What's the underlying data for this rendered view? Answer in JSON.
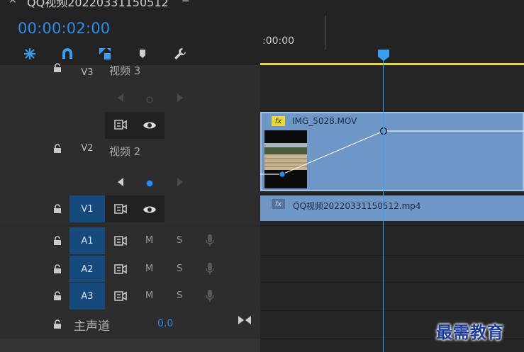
{
  "sequence": {
    "tab_close": "×",
    "tab_name": "QQ视频20220331150512",
    "tab_menu": "≡",
    "timecode": "00:00:02:00"
  },
  "toolbar": {
    "icons": [
      "snap-icon",
      "linked-selection-icon",
      "add-marker-icon",
      "marker-icon",
      "wrench-icon"
    ]
  },
  "ruler": {
    "label": ":00:00"
  },
  "tracks": {
    "v3": {
      "label": "V3",
      "name": "视频 3"
    },
    "v2": {
      "label": "V2",
      "name": "视频 2"
    },
    "v1": {
      "label": "V1"
    },
    "a1": {
      "label": "A1",
      "m": "M",
      "s": "S"
    },
    "a2": {
      "label": "A2",
      "m": "M",
      "s": "S"
    },
    "a3": {
      "label": "A3",
      "m": "M",
      "s": "S"
    },
    "master": {
      "name": "主声道",
      "value": "0.0"
    }
  },
  "clips": {
    "v2": {
      "fx": "fx",
      "name": "IMG_5028.MOV"
    },
    "v1": {
      "fx": "fx",
      "name": "QQ视频20220331150512.mp4"
    }
  },
  "watermark": "最需教育",
  "colors": {
    "accent": "#2d8ceb",
    "clip": "#6e97c8",
    "inout": "#e8d83a",
    "playhead": "#3a9ef0"
  }
}
